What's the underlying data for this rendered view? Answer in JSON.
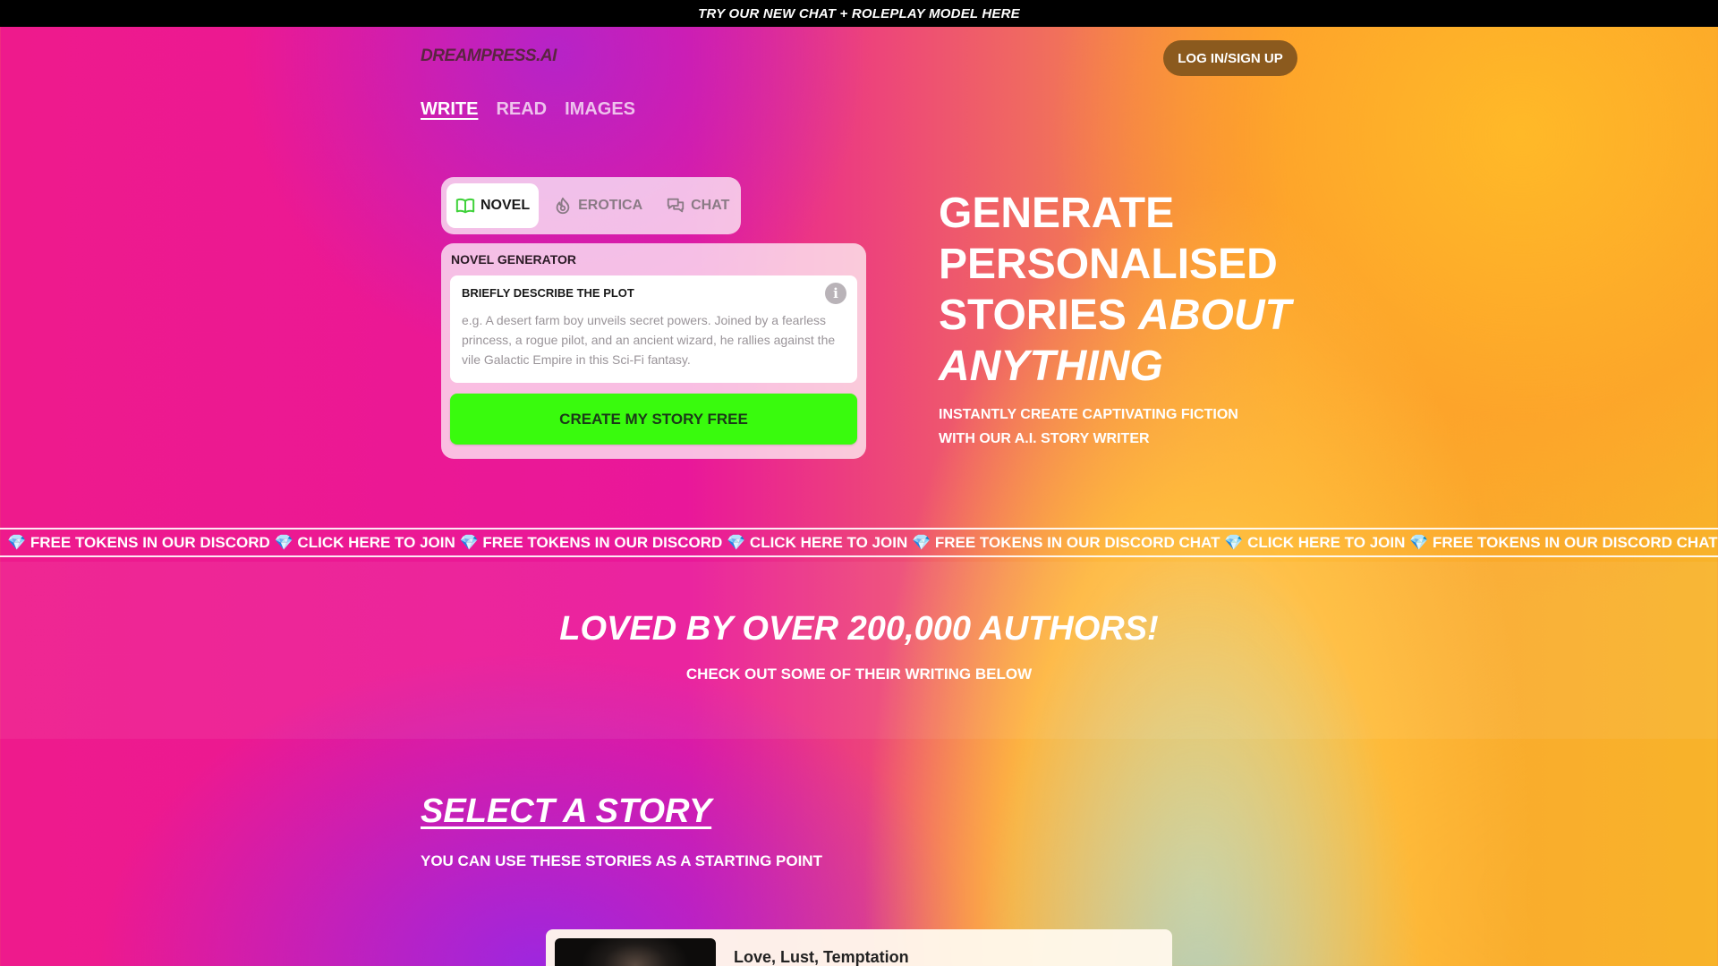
{
  "banner": {
    "text": "TRY OUR NEW CHAT + ROLEPLAY MODEL HERE"
  },
  "header": {
    "logo": "DREAMPRESS.AI",
    "login_label": "LOG IN/SIGN UP"
  },
  "nav": {
    "items": [
      {
        "label": "WRITE",
        "active": true
      },
      {
        "label": "READ",
        "active": false
      },
      {
        "label": "IMAGES",
        "active": false
      }
    ]
  },
  "mode_tabs": [
    {
      "label": "NOVEL",
      "icon": "book-icon",
      "active": true
    },
    {
      "label": "EROTICA",
      "icon": "flame-icon",
      "active": false
    },
    {
      "label": "CHAT",
      "icon": "chat-bubbles-icon",
      "active": false
    }
  ],
  "generator": {
    "title": "NOVEL GENERATOR",
    "plot_label": "BRIEFLY DESCRIBE THE PLOT",
    "plot_placeholder": "e.g. A desert farm boy unveils secret powers. Joined by a fearless princess, a rogue pilot, and an ancient wizard, he rallies against the vile Galactic Empire in this Sci-Fi fantasy.",
    "plot_value": "",
    "info_icon": "info-icon",
    "create_label": "CREATE MY STORY FREE"
  },
  "hero": {
    "line1": "GENERATE",
    "line2": "PERSONALISED",
    "line3a": "STORIES ",
    "line3b": "ABOUT",
    "line4": "ANYTHING",
    "subtitle": "INSTANTLY CREATE CAPTIVATING FICTION WITH OUR A.I. STORY WRITER"
  },
  "marquee": {
    "text": "💎 FREE TOKENS IN OUR DISCORD 💎 CLICK HERE TO JOIN 💎 FREE TOKENS IN OUR DISCORD 💎 CLICK HERE TO JOIN 💎 FREE TOKENS IN OUR DISCORD CHAT 💎 CLICK HERE TO JOIN 💎 FREE TOKENS IN OUR DISCORD CHAT 💎 CLICK HERE TO JOIN"
  },
  "social_proof": {
    "title": "LOVED BY OVER 200,000 AUTHORS!",
    "subtitle": "CHECK OUT SOME OF THEIR WRITING BELOW"
  },
  "stories": {
    "title": "SELECT A STORY",
    "subtitle": "YOU CAN USE THESE STORIES AS A STARTING POINT",
    "items": [
      {
        "title": "Love, Lust, Temptation"
      }
    ]
  },
  "colors": {
    "create_button": "#39fb0d",
    "login_button": "#8b5a1e",
    "topbar": "#000000"
  }
}
